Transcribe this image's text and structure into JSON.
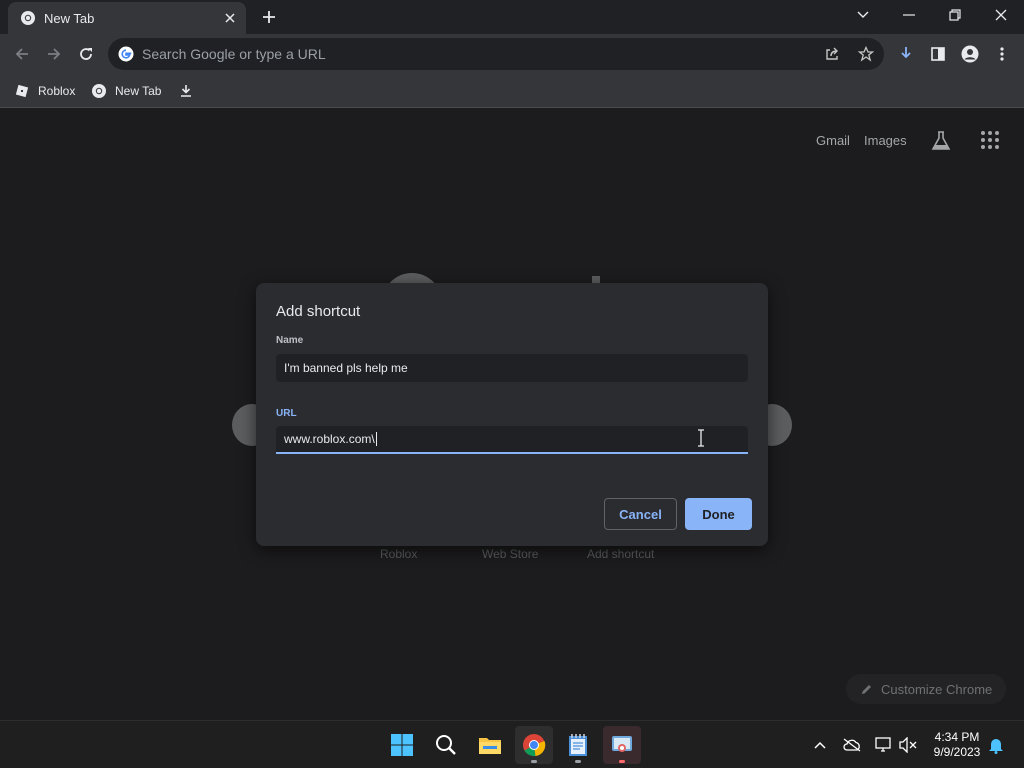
{
  "tabs": [
    {
      "title": "New Tab",
      "active": true
    }
  ],
  "omnibox": {
    "placeholder": "Search Google or type a URL"
  },
  "bookmarks": [
    {
      "label": "Roblox"
    },
    {
      "label": "New Tab"
    }
  ],
  "page": {
    "top_links": {
      "gmail": "Gmail",
      "images": "Images"
    },
    "shortcuts": [
      {
        "label": "Roblox"
      },
      {
        "label": "Web Store"
      },
      {
        "label": "Add shortcut"
      }
    ],
    "customize_label": "Customize Chrome"
  },
  "dialog": {
    "title": "Add shortcut",
    "name_label": "Name",
    "name_value": "I'm banned pls help me",
    "url_label": "URL",
    "url_value": "www.roblox.com\\",
    "cancel_label": "Cancel",
    "done_label": "Done"
  },
  "taskbar": {
    "time": "4:34 PM",
    "date": "9/9/2023"
  },
  "colors": {
    "accent": "#8ab4f8",
    "dialog_bg": "#2b2c2f",
    "toolbar_bg": "#35363a",
    "frame_bg": "#202124"
  }
}
